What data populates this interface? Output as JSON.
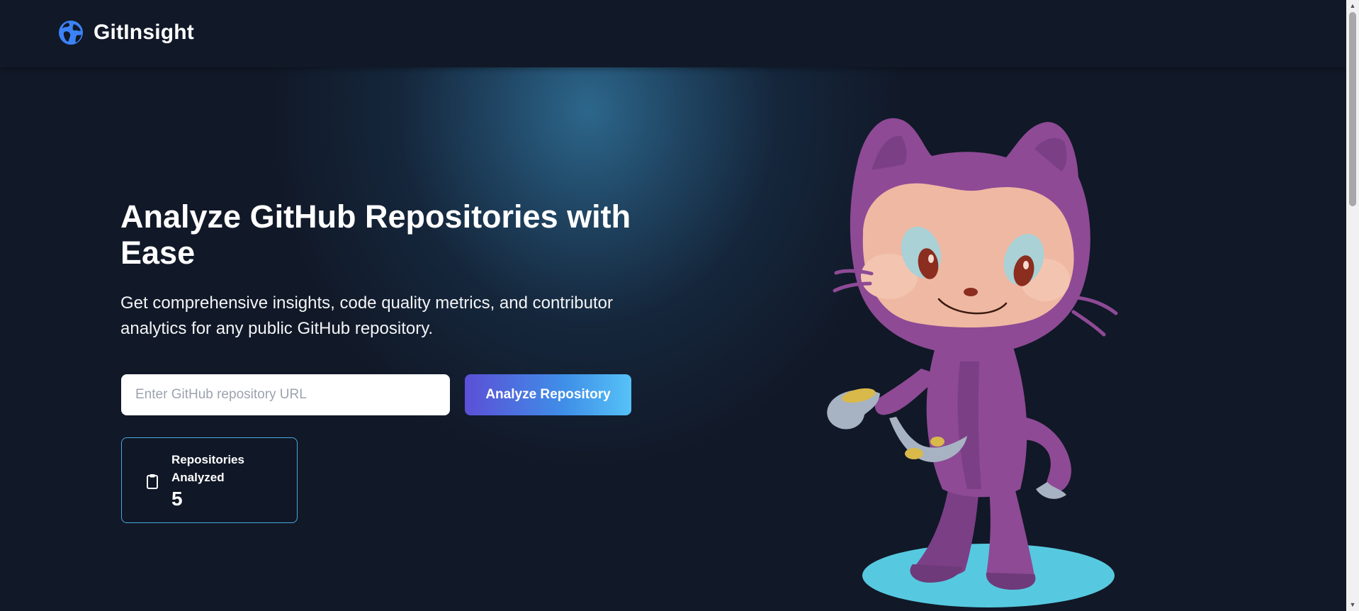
{
  "header": {
    "brand": "GitInsight",
    "logo_icon": "globe-icon"
  },
  "hero": {
    "title": "Analyze GitHub Repositories with Ease",
    "subtitle": "Get comprehensive insights, code quality metrics, and contributor analytics for any public GitHub repository.",
    "search": {
      "placeholder": "Enter GitHub repository URL",
      "value": ""
    },
    "analyze_label": "Analyze Repository",
    "stat": {
      "icon": "clipboard-icon",
      "label": "Repositories Analyzed",
      "value": "5"
    },
    "mascot": "octocat-mascot"
  },
  "colors": {
    "background": "#111827",
    "accent_start": "#5b50d6",
    "accent_end": "#56c2f7",
    "card_border": "#4aa8e0",
    "mascot_purple": "#8e4a95",
    "mascot_face": "#efb8a2",
    "mascot_base": "#56c9e0"
  },
  "scrollbar": {
    "scroll_position": 0
  }
}
